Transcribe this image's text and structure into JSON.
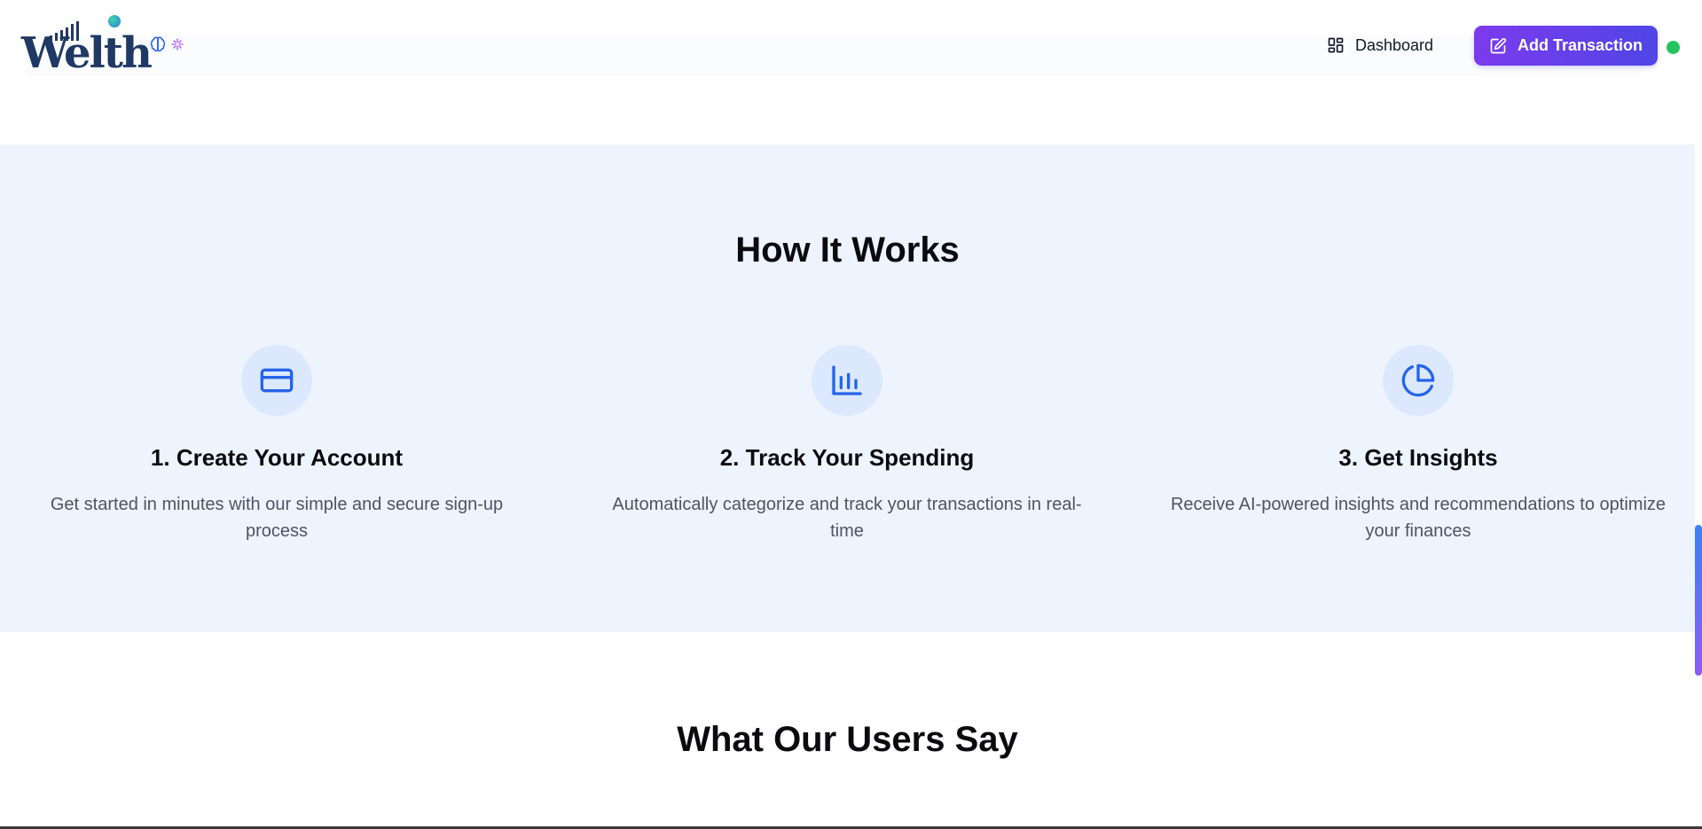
{
  "header": {
    "logo_text": "Welth",
    "nav_dashboard_label": "Dashboard",
    "add_transaction_label": "Add Transaction",
    "icons": {
      "logo": "welth-logo",
      "brain": "brain-icon",
      "sparkle": "sparkle-icon",
      "dashboard": "layout-dashboard-icon",
      "add_transaction": "pen-square-icon",
      "status": "online-status-dot"
    }
  },
  "how_it_works": {
    "title": "How It Works",
    "steps": [
      {
        "icon": "credit-card-icon",
        "title": "1. Create Your Account",
        "description": "Get started in minutes with our simple and secure sign-up process"
      },
      {
        "icon": "bar-chart-icon",
        "title": "2. Track Your Spending",
        "description": "Automatically categorize and track your transactions in real-time"
      },
      {
        "icon": "pie-chart-icon",
        "title": "3. Get Insights",
        "description": "Receive AI-powered insights and recommendations to optimize your finances"
      }
    ]
  },
  "testimonials": {
    "title": "What Our Users Say"
  },
  "colors": {
    "brand_navy": "#1f3864",
    "accent_blue": "#2563eb",
    "button_gradient_start": "#7c3aed",
    "button_gradient_end": "#4f46e5",
    "section_bg": "#eef4fd",
    "icon_circle_bg": "#dbe8fd",
    "status_green": "#22c55e"
  }
}
